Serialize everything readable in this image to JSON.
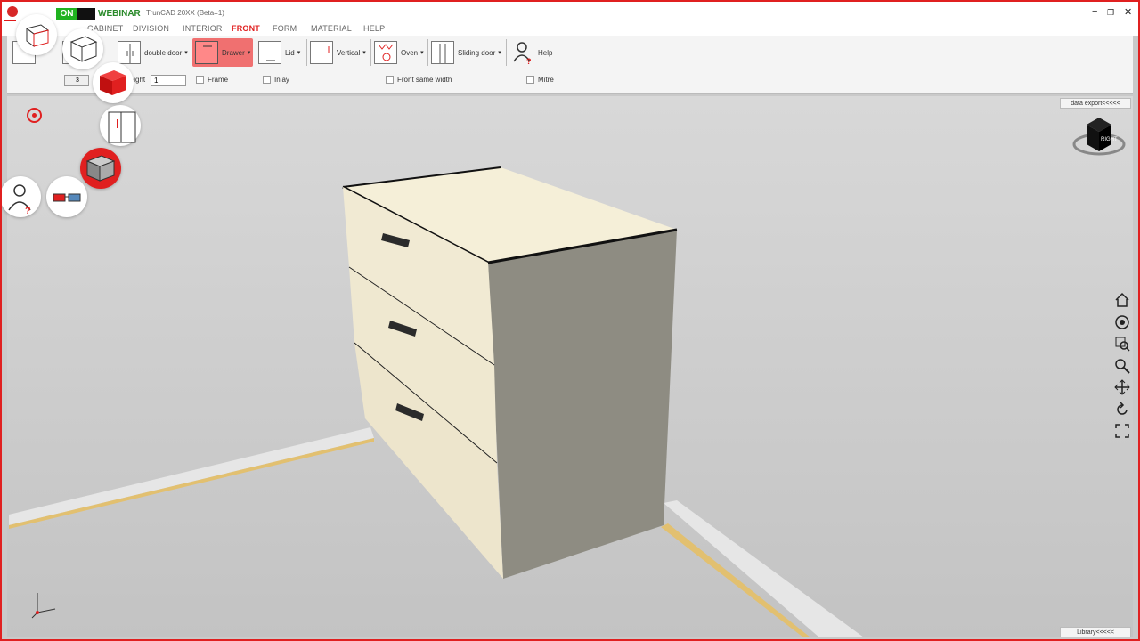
{
  "titlebar": {
    "on_label": "ON",
    "webinar_label": "WEBINAR",
    "app_title": "TrunCAD 20XX (Beta=1)",
    "minimize": "−",
    "maximize": "❐",
    "close": "✕"
  },
  "menu": {
    "items": [
      {
        "label": "CABINET"
      },
      {
        "label": "DIVISION"
      },
      {
        "label": "INTERIOR"
      },
      {
        "label": "FRONT",
        "active": true
      },
      {
        "label": "FORM"
      },
      {
        "label": "MATERIAL"
      },
      {
        "label": "HELP"
      }
    ],
    "active_color": "#e02020"
  },
  "ribbon": {
    "tools": {
      "double_door": "double door",
      "drawer": "Drawer",
      "lid": "Lid",
      "vertical": "Vertical",
      "oven": "Oven",
      "sliding_door": "Sliding door",
      "help": "Help"
    },
    "height_label": "Height",
    "height_value": "1",
    "count_value": "3",
    "options": {
      "frame": "Frame",
      "inlay": "Inlay",
      "front_same_width": "Front same width",
      "mitre": "Mitre"
    },
    "active_tool_color": "#f07070"
  },
  "viewport": {
    "data_export_label": "data export<<<<<",
    "library_label": "Library<<<<<",
    "nav_cube_label": "RIGHT"
  },
  "icons": {
    "left_toolbar": [
      "cabinet-wireframe-icon",
      "box-wireframe-icon",
      "red-cube-icon",
      "fridge-icon",
      "cube-view-icon",
      "user-help-icon",
      "3d-glasses-icon"
    ],
    "right_nav": [
      "home-icon",
      "orbit-icon",
      "zoom-window-icon",
      "zoom-icon",
      "pan-icon",
      "rotate-icon",
      "fit-icon"
    ]
  },
  "colors": {
    "accent": "#e02020",
    "cabinet_front": "#f3ecd6",
    "cabinet_side": "#8f8d82",
    "floor_strip": "#e8e8e8",
    "floor_edge": "#e8c77a"
  }
}
